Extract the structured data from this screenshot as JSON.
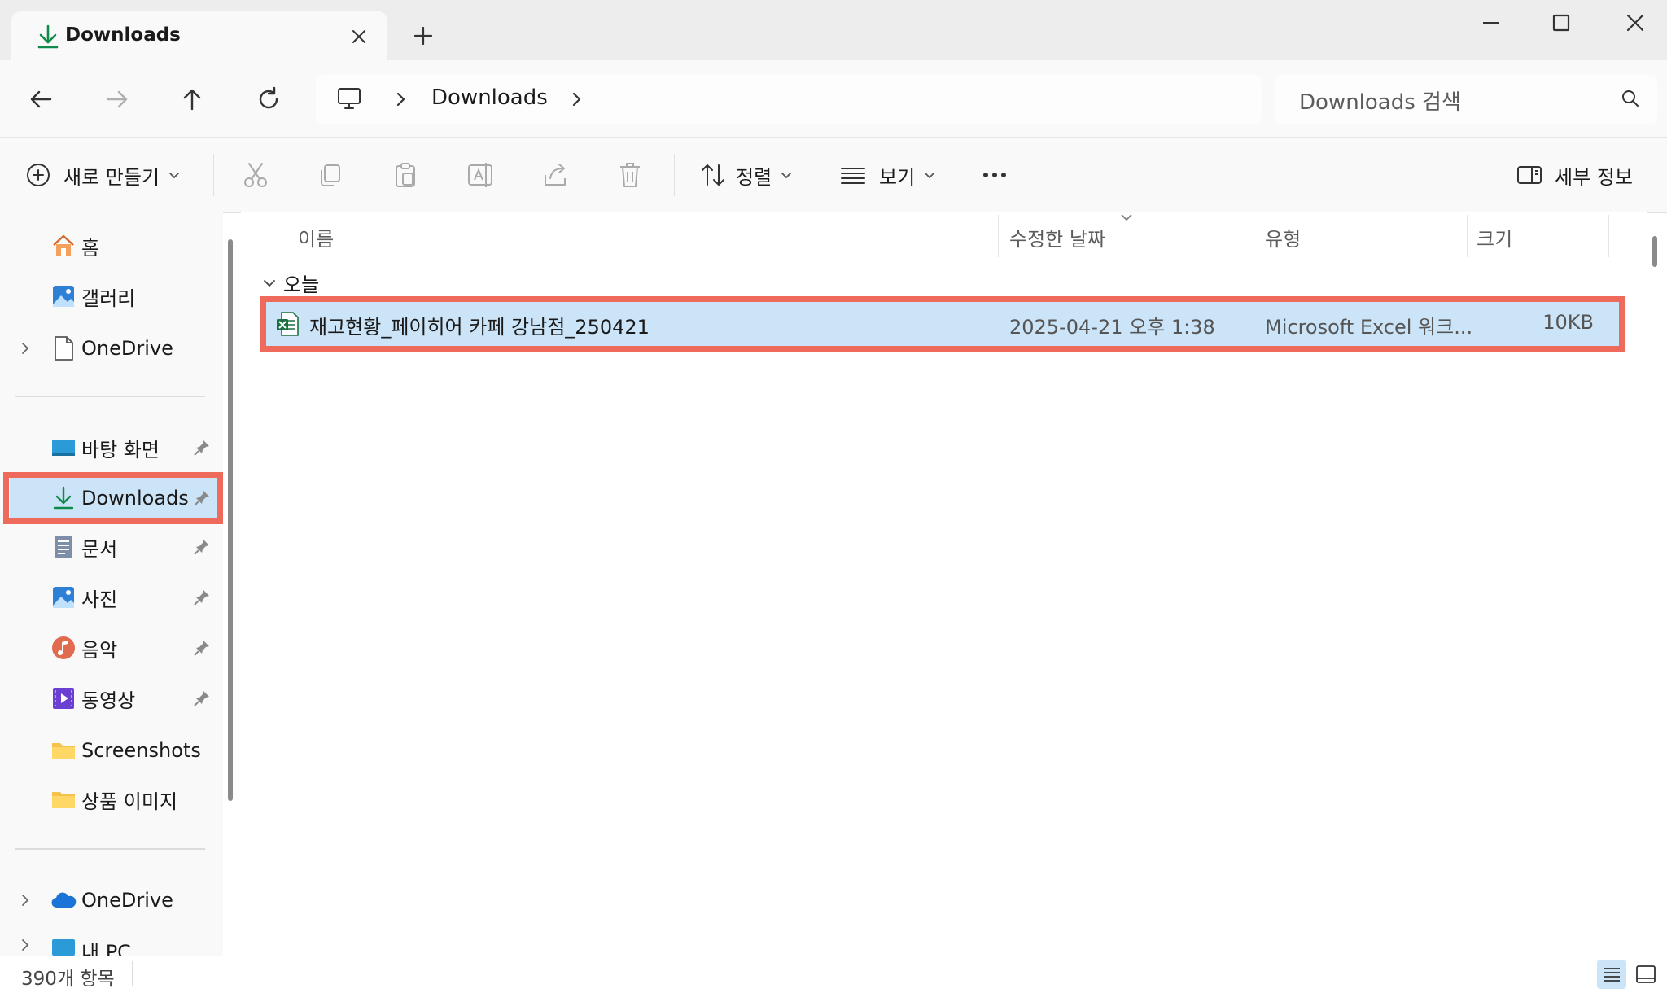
{
  "window": {
    "tab_title": "Downloads",
    "accent": "#0f8a4a"
  },
  "address": {
    "breadcrumb": "Downloads",
    "search_placeholder": "Downloads 검색"
  },
  "toolbar": {
    "new_label": "새로 만들기",
    "sort_label": "정렬",
    "view_label": "보기",
    "details_label": "세부 정보"
  },
  "sidebar": {
    "items": [
      {
        "label": "홈",
        "icon": "home-icon"
      },
      {
        "label": "갤러리",
        "icon": "gallery-icon"
      },
      {
        "label": "OneDrive",
        "icon": "document-icon"
      },
      {
        "label": "바탕 화면",
        "icon": "desktop-icon"
      },
      {
        "label": "Downloads",
        "icon": "download-icon"
      },
      {
        "label": "문서",
        "icon": "documents-icon"
      },
      {
        "label": "사진",
        "icon": "pictures-icon"
      },
      {
        "label": "음악",
        "icon": "music-icon"
      },
      {
        "label": "동영상",
        "icon": "videos-icon"
      },
      {
        "label": "Screenshots",
        "icon": "folder-icon"
      },
      {
        "label": "상품 이미지",
        "icon": "folder-icon"
      },
      {
        "label": "OneDrive",
        "icon": "cloud-icon"
      },
      {
        "label": "내 PC",
        "icon": "pc-icon"
      }
    ]
  },
  "columns": {
    "name": "이름",
    "modified": "수정한 날짜",
    "type": "유형",
    "size": "크기"
  },
  "group": {
    "label": "오늘"
  },
  "files": [
    {
      "name": "재고현황_페이히어 카페 강남점_250421",
      "modified": "2025-04-21 오후 1:38",
      "type": "Microsoft Excel 워크...",
      "size": "10KB"
    }
  ],
  "status": {
    "count": "390개 항목"
  },
  "colors": {
    "highlight": "#ee6a5a",
    "selection": "#cce4f7"
  }
}
